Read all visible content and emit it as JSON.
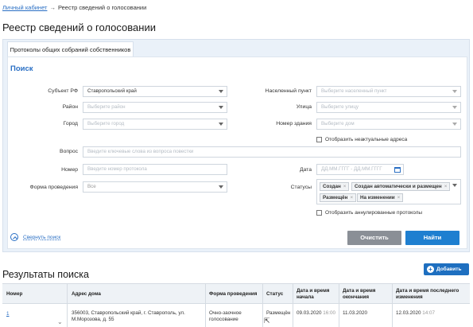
{
  "breadcrumb": {
    "home": "Личный кабинет",
    "separator": "→",
    "current": "Реестр сведений о голосовании"
  },
  "page_title": "Реестр сведений о голосовании",
  "tab": "Протоколы общих собраний собственников",
  "search": {
    "heading": "Поиск",
    "subject": {
      "label": "Субъект РФ",
      "value": "Ставропольский край"
    },
    "district": {
      "label": "Район",
      "placeholder": "Выберите район"
    },
    "city": {
      "label": "Город",
      "placeholder": "Выберите город"
    },
    "settlement": {
      "label": "Населенный пункт",
      "placeholder": "Выберите населенный пункт"
    },
    "street": {
      "label": "Улица",
      "placeholder": "Выберите улицу"
    },
    "building": {
      "label": "Номер здания",
      "placeholder": "Выберите дом"
    },
    "show_outdated": "Отобразить неактуальные адреса",
    "question": {
      "label": "Вопрос",
      "placeholder": "Введите ключевые слова из вопроса повестки"
    },
    "number": {
      "label": "Номер",
      "placeholder": "Введите номер протокола"
    },
    "date": {
      "label": "Дата",
      "placeholder": "ДД.ММ.ГГГГ - ДД.ММ.ГГГГ"
    },
    "form": {
      "label": "Форма проведения",
      "value": "Все"
    },
    "statuses": {
      "label": "Статусы",
      "tags": [
        "Создан",
        "Создан автоматически и размещен",
        "Размещён",
        "На изменении"
      ]
    },
    "show_annulled": "Отобразить аннулированные протоколы",
    "collapse": "Свернуть поиск",
    "clear": "Очистить",
    "find": "Найти"
  },
  "results": {
    "heading": "Результаты поиска",
    "add": "Добавить",
    "columns": [
      "Номер",
      "Адрес дома",
      "Форма проведения",
      "Статус",
      "Дата и время начала",
      "Дата и время окончания",
      "Дата и время последнего изменения"
    ],
    "rows": [
      {
        "number": "1",
        "address": "356003, Ставропольский край, г. Ставрополь, ул. М.Морозова, д. 55",
        "form": "Очно-заочное голосование",
        "status": "Размещён",
        "start_date": "09.03.2020",
        "start_time": "16:00",
        "end_date": "11.03.2020",
        "changed_date": "12.03.2020",
        "changed_time": "14:07"
      }
    ]
  },
  "colors": {
    "accent": "#2a6fc4",
    "primary_button": "#1e7fd0",
    "secondary_button": "#8a8f96",
    "panel": "#eaf1f9"
  }
}
